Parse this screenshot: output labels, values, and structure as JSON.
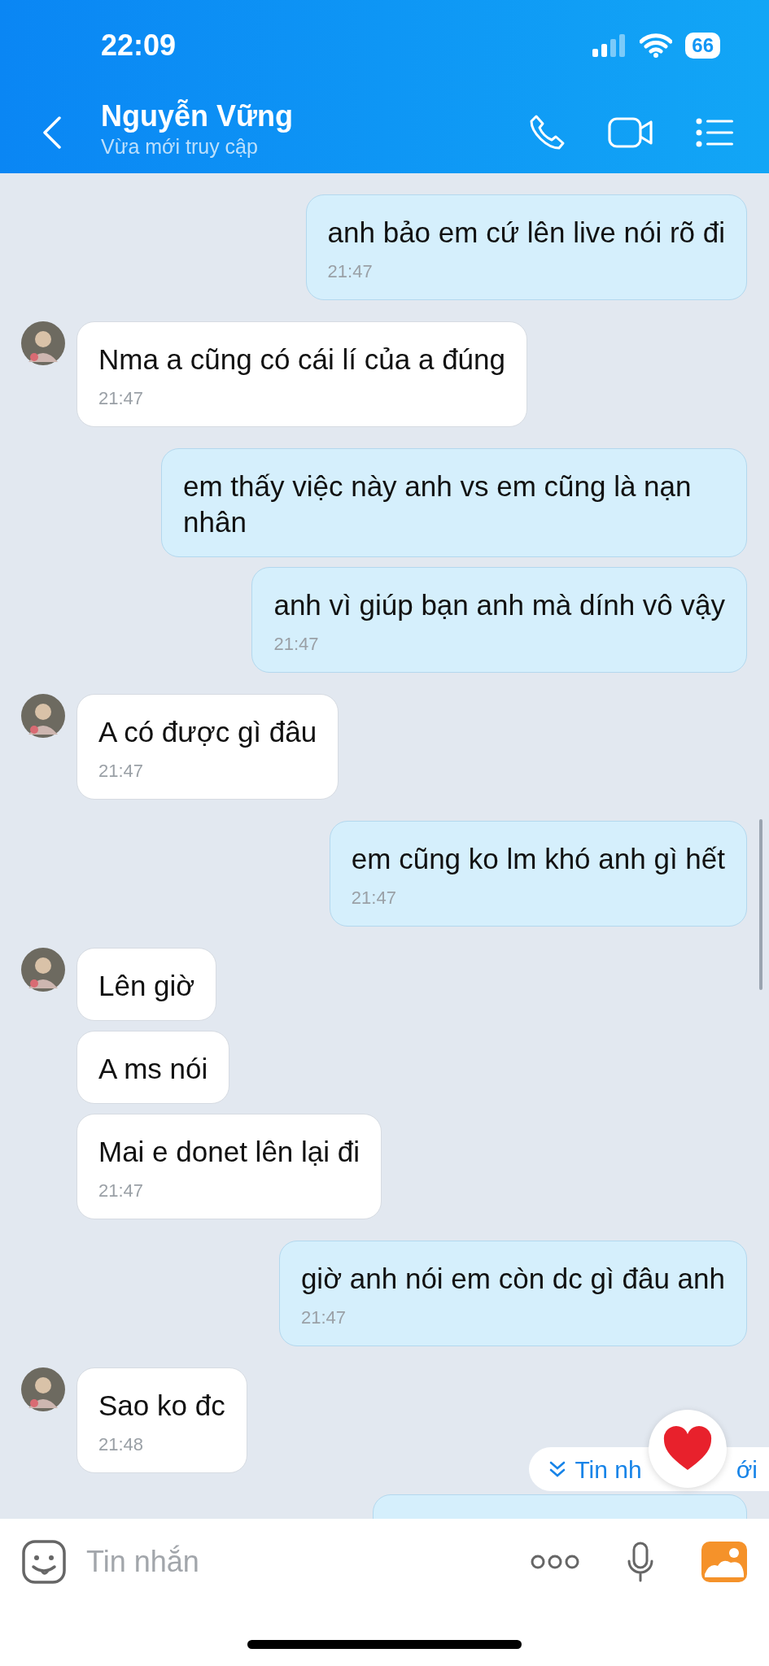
{
  "status_bar": {
    "time": "22:09",
    "battery": "66"
  },
  "header": {
    "name": "Nguyễn Vững",
    "status": "Vừa mới truy cập"
  },
  "messages": [
    {
      "kind": "out",
      "text": "anh bảo em cứ lên live nói rõ đi",
      "time": "21:47"
    },
    {
      "kind": "in",
      "avatar": true,
      "text": "Nma a cũng có cái lí của a đúng",
      "time": "21:47"
    },
    {
      "kind": "out",
      "text": "em thấy việc này anh vs em cũng là nạn nhân"
    },
    {
      "kind": "out",
      "text": "anh vì giúp bạn anh mà dính vô vậy",
      "time": "21:47"
    },
    {
      "kind": "in",
      "avatar": true,
      "text": "A có được gì đâu",
      "time": "21:47"
    },
    {
      "kind": "out",
      "text": "em cũng ko lm khó anh gì hết",
      "time": "21:47"
    },
    {
      "kind": "in",
      "avatar": true,
      "text": "Lên giờ"
    },
    {
      "kind": "in",
      "avatar": false,
      "text": "A ms nói"
    },
    {
      "kind": "in",
      "avatar": false,
      "text": "Mai e donet lên lại đi",
      "time": "21:47"
    },
    {
      "kind": "out",
      "text": "giờ anh nói em còn dc gì đâu anh",
      "time": "21:47"
    },
    {
      "kind": "in",
      "avatar": true,
      "text": "Sao ko đc",
      "time": "21:48"
    },
    {
      "kind": "out"
    }
  ],
  "new_messages_button": {
    "parts": [
      "Tin nh",
      "ới"
    ]
  },
  "composer": {
    "placeholder": "Tin nhắn"
  }
}
